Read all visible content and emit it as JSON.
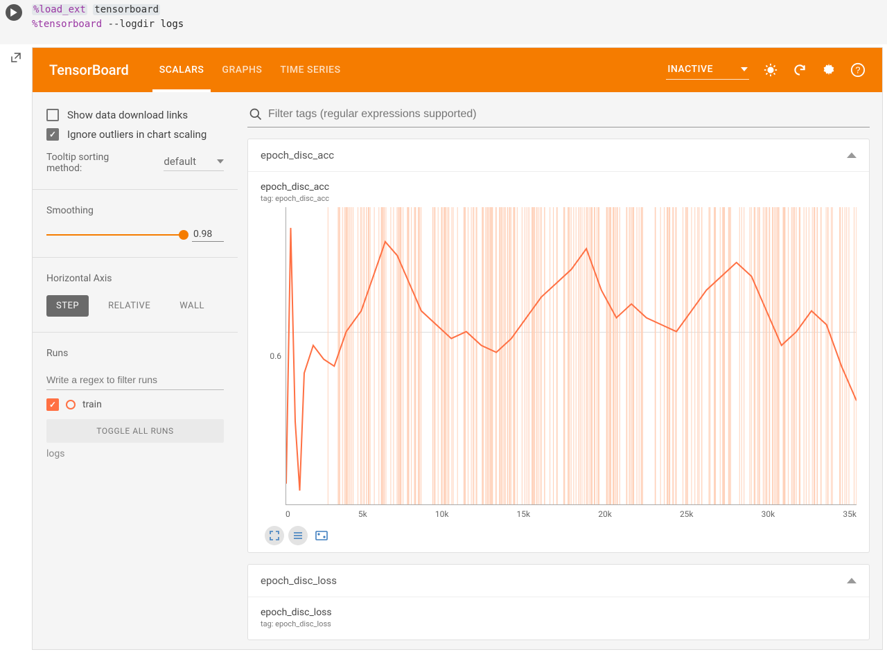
{
  "cell": {
    "magic1": "%load_ext",
    "arg1": "tensorboard",
    "magic2": "%tensorboard",
    "flag": "--logdir",
    "arg2": "logs"
  },
  "header": {
    "title": "TensorBoard",
    "tabs": [
      "SCALARS",
      "GRAPHS",
      "TIME SERIES"
    ],
    "active_tab": 0,
    "status": "INACTIVE"
  },
  "sidebar": {
    "show_download": "Show data download links",
    "ignore_outliers": "Ignore outliers in chart scaling",
    "tooltip_label": "Tooltip sorting method:",
    "tooltip_value": "default",
    "smoothing_label": "Smoothing",
    "smoothing_value": "0.98",
    "axis_label": "Horizontal Axis",
    "axis_options": [
      "STEP",
      "RELATIVE",
      "WALL"
    ],
    "axis_active": 0,
    "runs_label": "Runs",
    "runs_placeholder": "Write a regex to filter runs",
    "run_name": "train",
    "toggle_runs": "TOGGLE ALL RUNS",
    "logs": "logs"
  },
  "main": {
    "filter_placeholder": "Filter tags (regular expressions supported)"
  },
  "charts": [
    {
      "section": "epoch_disc_acc",
      "title": "epoch_disc_acc",
      "tag": "tag: epoch_disc_acc"
    },
    {
      "section": "epoch_disc_loss",
      "title": "epoch_disc_loss",
      "tag": "tag: epoch_disc_loss"
    }
  ],
  "chart_data": {
    "type": "line",
    "title": "epoch_disc_acc",
    "xlabel": "step",
    "ylabel": "",
    "ylim": [
      0.35,
      0.78
    ],
    "xlim": [
      0,
      38000
    ],
    "y_tick": 0.6,
    "x_ticks": [
      "0",
      "5k",
      "10k",
      "15k",
      "20k",
      "25k",
      "30k",
      "35k"
    ],
    "series": [
      {
        "name": "train",
        "color": "#ff7043",
        "x": [
          0,
          300,
          600,
          900,
          1200,
          1800,
          2500,
          3200,
          4000,
          5000,
          5800,
          6600,
          7400,
          8200,
          9000,
          10000,
          11000,
          12000,
          13000,
          14000,
          15000,
          16000,
          17000,
          18000,
          19000,
          20000,
          21000,
          22000,
          23000,
          24000,
          25000,
          26000,
          27000,
          28000,
          29000,
          30000,
          31000,
          32000,
          33000,
          34000,
          35000,
          36000,
          37000,
          38000
        ],
        "values": [
          0.38,
          0.75,
          0.47,
          0.37,
          0.54,
          0.58,
          0.56,
          0.55,
          0.6,
          0.63,
          0.68,
          0.73,
          0.71,
          0.67,
          0.63,
          0.61,
          0.59,
          0.6,
          0.58,
          0.57,
          0.59,
          0.62,
          0.65,
          0.67,
          0.69,
          0.72,
          0.66,
          0.62,
          0.64,
          0.62,
          0.61,
          0.6,
          0.63,
          0.66,
          0.68,
          0.7,
          0.68,
          0.63,
          0.58,
          0.6,
          0.63,
          0.61,
          0.55,
          0.5
        ]
      }
    ]
  }
}
